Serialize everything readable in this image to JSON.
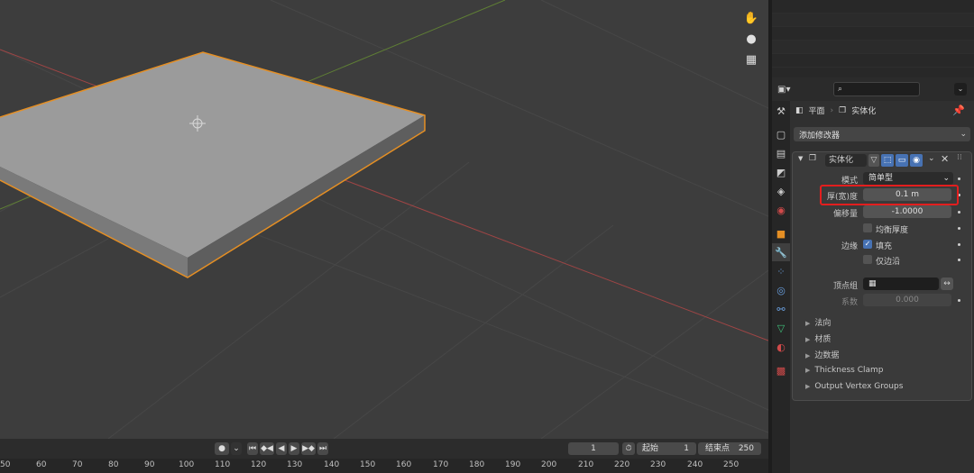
{
  "colors": {
    "accent": "#4772b3",
    "selection_outline": "#e58f24",
    "highlight_box": "#e31e1e",
    "x_axis": "#b54848",
    "y_axis": "#6a8f3a"
  },
  "viewport": {
    "gizmo_icons": [
      "hand-pan-icon",
      "camera-icon",
      "grid-perspective-icon"
    ]
  },
  "properties": {
    "search_placeholder": "",
    "breadcrumb": {
      "object": "平面",
      "modifier": "实体化"
    },
    "add_modifier": "添加修改器",
    "modifier": {
      "name": "实体化",
      "mode_label": "模式",
      "mode_value": "简单型",
      "thickness_label": "厚(宽)度",
      "thickness_value": "0.1 m",
      "offset_label": "偏移量",
      "offset_value": "-1.0000",
      "even_label": "均衡厚度",
      "even_checked": false,
      "rim_label": "边缘",
      "fill_label": "填充",
      "fill_checked": true,
      "only_rim_label": "仅边沿",
      "only_rim_checked": false,
      "vgroup_label": "顶点组",
      "vgroup_value": "",
      "factor_label": "系数",
      "factor_value": "0.000",
      "subpanels": [
        "法向",
        "材质",
        "边数据",
        "Thickness Clamp",
        "Output Vertex Groups"
      ]
    }
  },
  "timeline": {
    "current_frame": "1",
    "start_label": "起始",
    "start_value": "1",
    "end_label": "结束点",
    "end_value": "250",
    "ruler": [
      "50",
      "60",
      "70",
      "80",
      "90",
      "100",
      "110",
      "120",
      "130",
      "140",
      "150",
      "160",
      "170",
      "180",
      "190",
      "200",
      "210",
      "220",
      "230",
      "240",
      "250"
    ]
  }
}
